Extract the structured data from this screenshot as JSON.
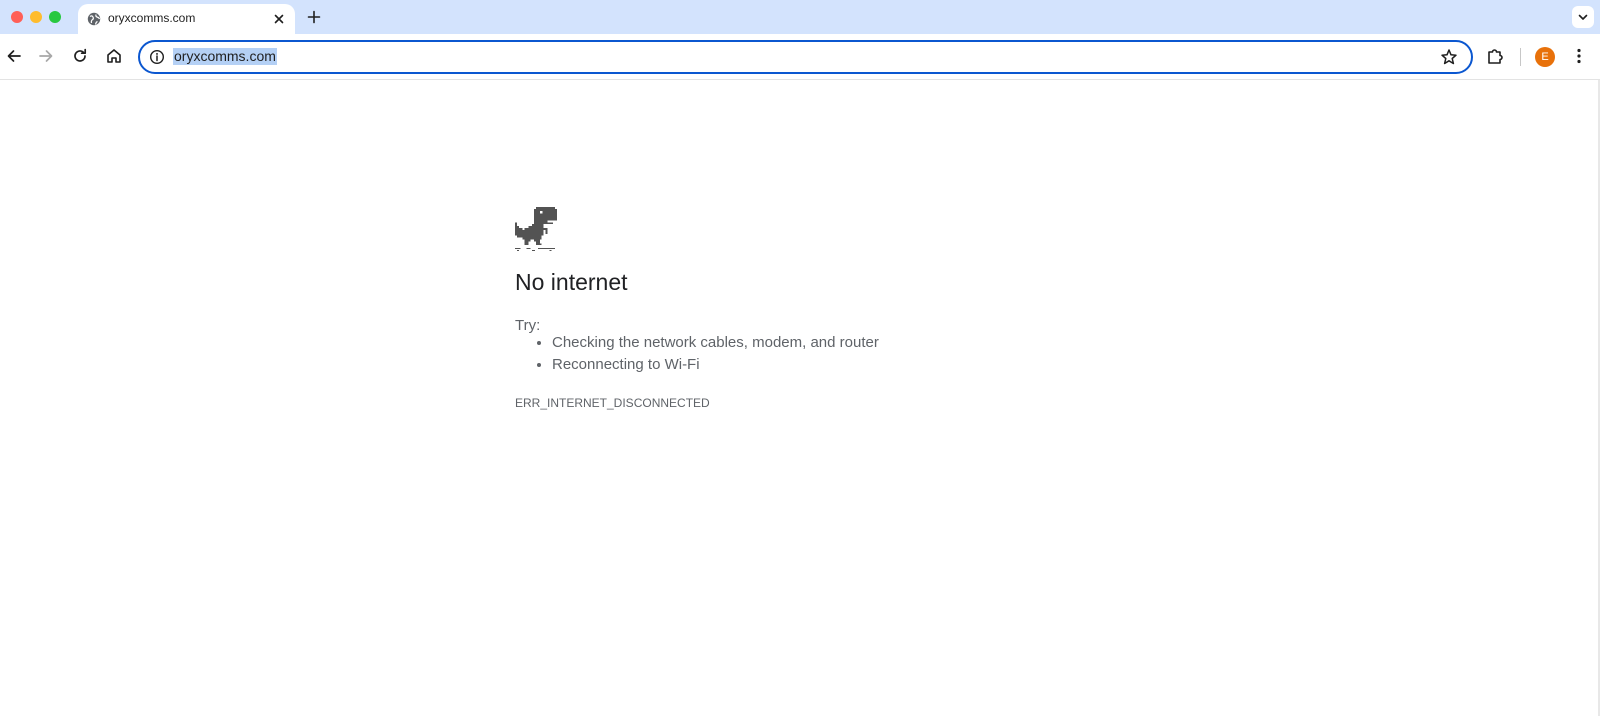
{
  "browser": {
    "tab": {
      "title": "oryxcomms.com"
    },
    "omnibox": {
      "url": "oryxcomms.com"
    },
    "profile": {
      "initial": "E"
    }
  },
  "error_page": {
    "heading": "No internet",
    "try_label": "Try:",
    "suggestions": [
      "Checking the network cables, modem, and router",
      "Reconnecting to Wi-Fi"
    ],
    "error_code": "ERR_INTERNET_DISCONNECTED"
  },
  "colors": {
    "tabstrip_bg": "#d3e3fd",
    "accent_blue": "#0b57d0",
    "selection": "#b4d0f5",
    "avatar": "#e8710a",
    "text_secondary": "#5f6368"
  }
}
